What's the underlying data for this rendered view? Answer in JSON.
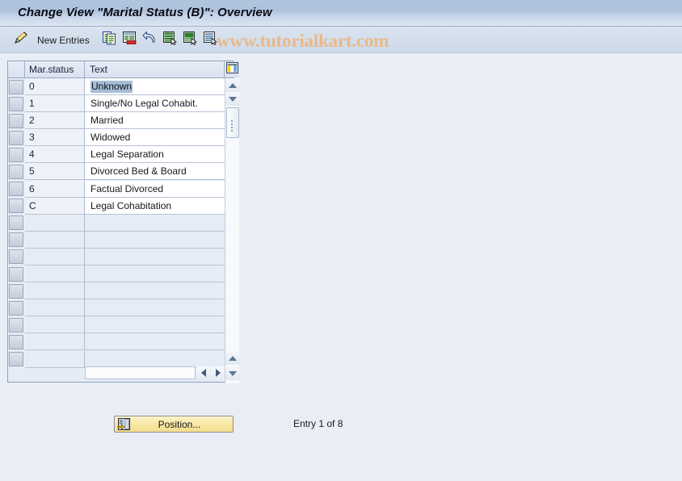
{
  "window": {
    "title": "Change View \"Marital Status (B)\": Overview"
  },
  "watermark": {
    "text": "www.tutorialkart.com",
    "color": "#e8b98a"
  },
  "toolbar": {
    "edit_icon": "pencil-icon",
    "new_entries_label": "New Entries",
    "buttons": [
      {
        "name": "copy-as-icon",
        "icon": "copy-documents-icon"
      },
      {
        "name": "delete-icon",
        "icon": "delete-row-icon"
      },
      {
        "name": "undo-icon",
        "icon": "undo-arrow-icon"
      },
      {
        "name": "select-all-icon",
        "icon": "select-all-icon"
      },
      {
        "name": "deselect-all-icon",
        "icon": "deselect-all-icon"
      },
      {
        "name": "details-icon",
        "icon": "details-icon"
      }
    ]
  },
  "table": {
    "config_icon": "table-settings-icon",
    "columns": [
      {
        "key": "code",
        "label": "Mar.status"
      },
      {
        "key": "text",
        "label": "Text"
      }
    ],
    "rows": [
      {
        "code": "0",
        "text": "Unknown",
        "selected": true
      },
      {
        "code": "1",
        "text": "Single/No Legal Cohabit.",
        "selected": false
      },
      {
        "code": "2",
        "text": "Married",
        "selected": false
      },
      {
        "code": "3",
        "text": "Widowed",
        "selected": false
      },
      {
        "code": "4",
        "text": "Legal Separation",
        "selected": false
      },
      {
        "code": "5",
        "text": "Divorced Bed & Board",
        "selected": false
      },
      {
        "code": "6",
        "text": "Factual Divorced",
        "selected": false
      },
      {
        "code": "C",
        "text": "Legal Cohabitation",
        "selected": false
      }
    ],
    "empty_row_count": 9,
    "scroll": {
      "up_icon": "scroll-up-arrow-icon",
      "down_icon": "scroll-down-arrow-icon",
      "left_icon": "scroll-left-arrow-icon",
      "right_icon": "scroll-right-arrow-icon"
    }
  },
  "footer": {
    "position_button_label": "Position...",
    "position_button_icon": "position-icon",
    "entry_info": "Entry 1 of 8"
  },
  "colors": {
    "title_bar": "#b0c4de",
    "toolbar": "#d3deec",
    "body": "#e9eef6",
    "selection": "#a8bdd4",
    "button_yellow": "#f8e7a2"
  }
}
